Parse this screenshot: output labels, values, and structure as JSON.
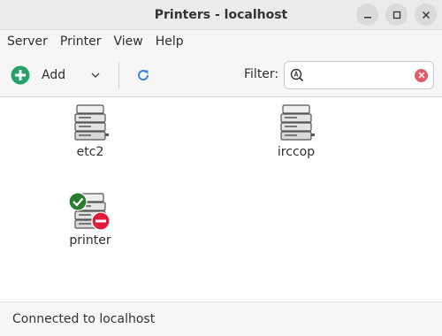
{
  "window": {
    "title": "Printers - localhost"
  },
  "menu": {
    "items": [
      "Server",
      "Printer",
      "View",
      "Help"
    ]
  },
  "toolbar": {
    "add_label": "Add",
    "filter_label": "Filter:",
    "filter_value": "",
    "filter_placeholder": ""
  },
  "printers": [
    {
      "name": "etc2",
      "status": "normal"
    },
    {
      "name": "irccop",
      "status": "normal"
    },
    {
      "name": "printer",
      "status": "default-stopped"
    }
  ],
  "statusbar": {
    "text": "Connected to localhost"
  },
  "colors": {
    "add_green": "#26a269",
    "refresh_blue": "#3584e4",
    "default_badge": "#2a7d2e",
    "stopped_badge": "#e01b3c"
  },
  "icons": [
    "minimize-icon",
    "maximize-icon",
    "close-icon",
    "add-icon",
    "chevron-down-icon",
    "refresh-icon",
    "search-icon",
    "clear-icon",
    "printer-icon",
    "default-check-icon",
    "stopped-icon"
  ]
}
